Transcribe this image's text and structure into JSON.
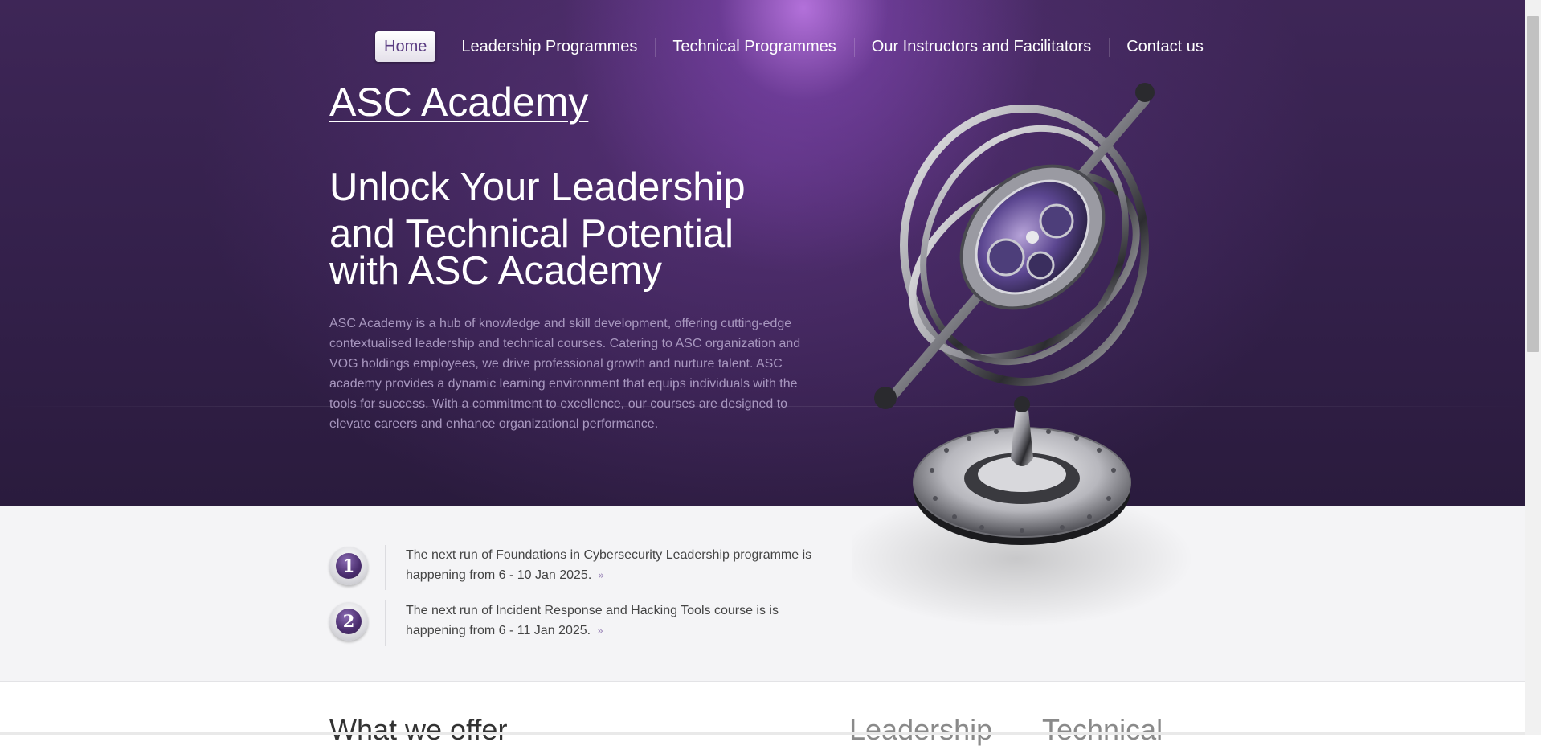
{
  "nav": {
    "items": [
      {
        "label": "Home",
        "active": true
      },
      {
        "label": "Leadership Programmes"
      },
      {
        "label": "Technical Programmes"
      },
      {
        "label": "Our Instructors and Facilitators"
      },
      {
        "label": "Contact us"
      }
    ]
  },
  "hero": {
    "brand": "ASC Academy",
    "headline": {
      "line1": "Unlock Your Leadership",
      "line2": "and Technical Potential",
      "line3": "with ASC Academy"
    },
    "intro": "ASC Academy is a hub of knowledge and skill development, offering cutting-edge contextualised leadership and technical courses. Catering to ASC organization and VOG holdings employees, we drive professional growth and nurture talent. ASC academy provides a dynamic learning environment that equips individuals with the tools for success. With a commitment to excellence, our courses are designed to elevate careers and enhance organizational performance.",
    "image_icon": "gyroscope-illustration"
  },
  "news": [
    {
      "number": "1",
      "text": "The next run of Foundations in Cybersecurity Leadership programme is happening from 6 - 10 Jan 2025.",
      "more_icon": "double-chevron-right-icon",
      "more_glyph": "»"
    },
    {
      "number": "2",
      "text": "The next run of Incident Response and Hacking Tools course is is happening from 6 - 11 Jan 2025.",
      "more_icon": "double-chevron-right-icon",
      "more_glyph": "»"
    }
  ],
  "offer": {
    "title": "What we offer",
    "columns": [
      {
        "title": "Leadership"
      },
      {
        "title": "Technical"
      }
    ]
  },
  "colors": {
    "hero_bg": "#33204a",
    "hero_glow": "#be78e6",
    "nav_active_text": "#5b3d82",
    "intro_text": "#a897bf",
    "badge_purple": "#4a2d6e",
    "news_bg": "#f4f4f6"
  }
}
